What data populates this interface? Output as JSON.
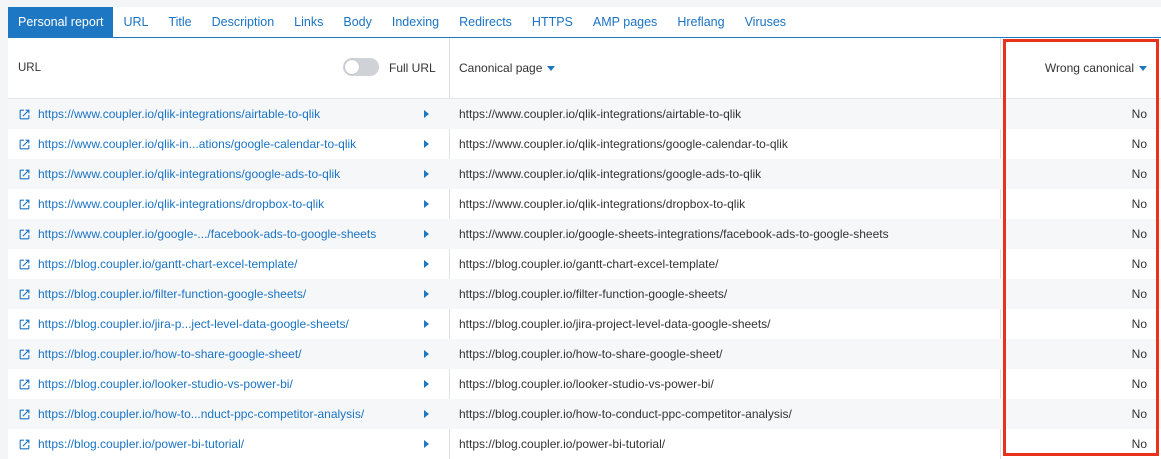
{
  "tabs": [
    "Personal report",
    "URL",
    "Title",
    "Description",
    "Links",
    "Body",
    "Indexing",
    "Redirects",
    "HTTPS",
    "AMP pages",
    "Hreflang",
    "Viruses"
  ],
  "active_tab": 0,
  "header": {
    "url_label": "URL",
    "full_url_label": "Full URL",
    "canonical_label": "Canonical page",
    "wrong_canonical_label": "Wrong canonical"
  },
  "colors": {
    "accent": "#1d77c2",
    "link": "#1a73c4",
    "highlight": "#e8321c"
  },
  "rows": [
    {
      "url": "https://www.coupler.io/qlik-integrations/airtable-to-qlik",
      "canonical": "https://www.coupler.io/qlik-integrations/airtable-to-qlik",
      "wrong": "No"
    },
    {
      "url": "https://www.coupler.io/qlik-in...ations/google-calendar-to-qlik",
      "canonical": "https://www.coupler.io/qlik-integrations/google-calendar-to-qlik",
      "wrong": "No"
    },
    {
      "url": "https://www.coupler.io/qlik-integrations/google-ads-to-qlik",
      "canonical": "https://www.coupler.io/qlik-integrations/google-ads-to-qlik",
      "wrong": "No"
    },
    {
      "url": "https://www.coupler.io/qlik-integrations/dropbox-to-qlik",
      "canonical": "https://www.coupler.io/qlik-integrations/dropbox-to-qlik",
      "wrong": "No"
    },
    {
      "url": "https://www.coupler.io/google-.../facebook-ads-to-google-sheets",
      "canonical": "https://www.coupler.io/google-sheets-integrations/facebook-ads-to-google-sheets",
      "wrong": "No"
    },
    {
      "url": "https://blog.coupler.io/gantt-chart-excel-template/",
      "canonical": "https://blog.coupler.io/gantt-chart-excel-template/",
      "wrong": "No"
    },
    {
      "url": "https://blog.coupler.io/filter-function-google-sheets/",
      "canonical": "https://blog.coupler.io/filter-function-google-sheets/",
      "wrong": "No"
    },
    {
      "url": "https://blog.coupler.io/jira-p...ject-level-data-google-sheets/",
      "canonical": "https://blog.coupler.io/jira-project-level-data-google-sheets/",
      "wrong": "No"
    },
    {
      "url": "https://blog.coupler.io/how-to-share-google-sheet/",
      "canonical": "https://blog.coupler.io/how-to-share-google-sheet/",
      "wrong": "No"
    },
    {
      "url": "https://blog.coupler.io/looker-studio-vs-power-bi/",
      "canonical": "https://blog.coupler.io/looker-studio-vs-power-bi/",
      "wrong": "No"
    },
    {
      "url": "https://blog.coupler.io/how-to...nduct-ppc-competitor-analysis/",
      "canonical": "https://blog.coupler.io/how-to-conduct-ppc-competitor-analysis/",
      "wrong": "No"
    },
    {
      "url": "https://blog.coupler.io/power-bi-tutorial/",
      "canonical": "https://blog.coupler.io/power-bi-tutorial/",
      "wrong": "No"
    }
  ]
}
